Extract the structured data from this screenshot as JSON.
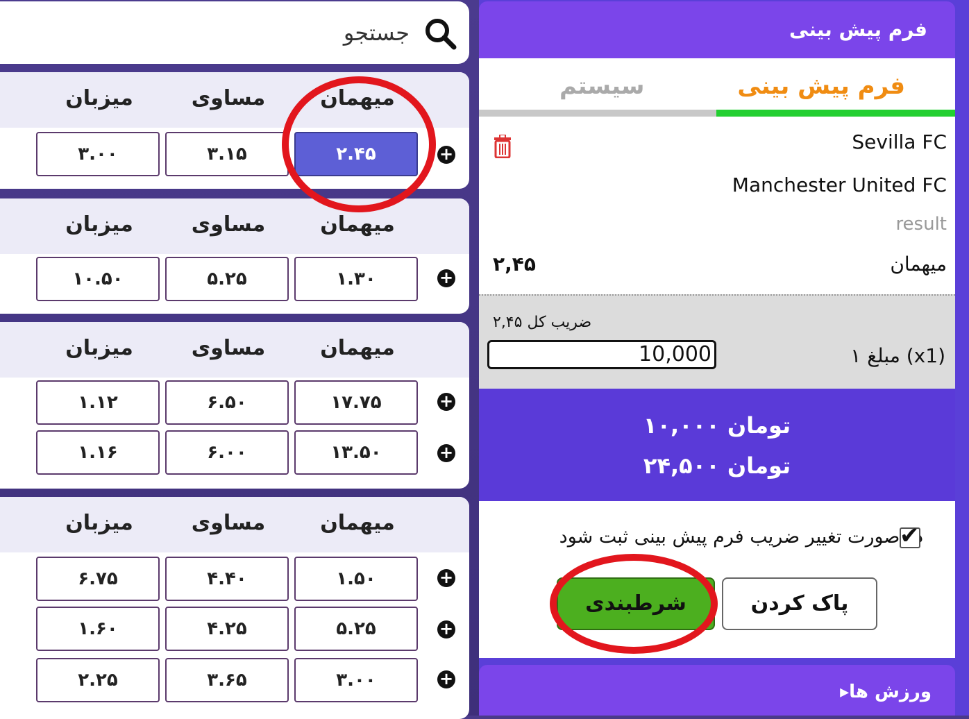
{
  "search": {
    "placeholder_label": "جستجو"
  },
  "odds_headers": {
    "away": "میهمان",
    "draw": "مساوی",
    "home": "میزبان"
  },
  "matches": [
    {
      "rows": [
        {
          "away": "۲.۴۵",
          "draw": "۳.۱۵",
          "home": "۳.۰۰",
          "selected": "away"
        }
      ]
    },
    {
      "rows": [
        {
          "away": "۱.۳۰",
          "draw": "۵.۲۵",
          "home": "۱۰.۵۰"
        }
      ]
    },
    {
      "rows": [
        {
          "away": "۱۷.۷۵",
          "draw": "۶.۵۰",
          "home": "۱.۱۲"
        },
        {
          "away": "۱۳.۵۰",
          "draw": "۶.۰۰",
          "home": "۱.۱۶"
        }
      ]
    },
    {
      "rows": [
        {
          "away": "۱.۵۰",
          "draw": "۴.۴۰",
          "home": "۶.۷۵"
        },
        {
          "away": "۵.۲۵",
          "draw": "۴.۲۵",
          "home": "۱.۶۰"
        },
        {
          "away": "۳.۰۰",
          "draw": "۳.۶۵",
          "home": "۲.۲۵"
        }
      ]
    }
  ],
  "bet_slip": {
    "title": "فرم پیش بینی",
    "tabs": {
      "form": "فرم پیش بینی",
      "system": "سیستم"
    },
    "team1": "Sevilla FC",
    "team2": "Manchester United FC",
    "result_label": "result",
    "pick_name": "میهمان",
    "pick_odd": "۲,۴۵",
    "total_odds_label": "ضریب کل ۲,۴۵",
    "stake_label": "۱ مبلغ (x1)",
    "stake_value": "10,000",
    "total_stake": "۱۰,۰۰۰ تومان",
    "potential_win": "۲۴,۵۰۰ تومان",
    "accept_changes": "در صورت تغییر ضریب فرم پیش بینی ثبت شود",
    "accept_checked": true,
    "bet_button": "شرطبندی",
    "clear_button": "پاک کردن"
  },
  "sports_bar": {
    "label": "ورزش ها",
    "arrow": "▸"
  },
  "colors": {
    "purple_bar": "#7b45ea",
    "purple_totals": "#5a3ad8",
    "selected_odd": "#5d5fd6",
    "bet_green": "#4caf1f",
    "tab_active": "#f08c12",
    "annotation_red": "#e2161d"
  }
}
